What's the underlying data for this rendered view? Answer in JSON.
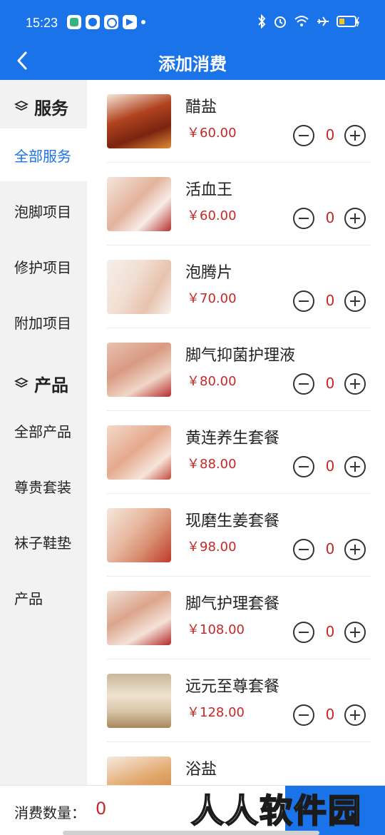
{
  "status_bar": {
    "time": "15:23"
  },
  "header": {
    "title": "添加消费"
  },
  "sidebar": {
    "services_group": "服务",
    "service_items": [
      "全部服务",
      "泡脚项目",
      "修护项目",
      "附加项目"
    ],
    "products_group": "产品",
    "product_items": [
      "全部产品",
      "尊贵套装",
      "袜子鞋垫",
      "产品"
    ]
  },
  "products": [
    {
      "name": "醋盐",
      "price": "￥60.00",
      "qty": "0"
    },
    {
      "name": "活血王",
      "price": "￥60.00",
      "qty": "0"
    },
    {
      "name": "泡腾片",
      "price": "￥70.00",
      "qty": "0"
    },
    {
      "name": "脚气抑菌护理液",
      "price": "￥80.00",
      "qty": "0"
    },
    {
      "name": "黄连养生套餐",
      "price": "￥88.00",
      "qty": "0"
    },
    {
      "name": "现磨生姜套餐",
      "price": "￥98.00",
      "qty": "0"
    },
    {
      "name": "脚气护理套餐",
      "price": "￥108.00",
      "qty": "0"
    },
    {
      "name": "远元至尊套餐",
      "price": "￥128.00",
      "qty": "0"
    },
    {
      "name": "浴盐",
      "price": "",
      "qty": ""
    }
  ],
  "footer": {
    "count_label": "消费数量：",
    "count_value": "0"
  },
  "watermark": "人人软件园",
  "colors": {
    "primary": "#1a73e8",
    "price": "#c62828",
    "sidebar_bg": "#f2f2f2"
  }
}
